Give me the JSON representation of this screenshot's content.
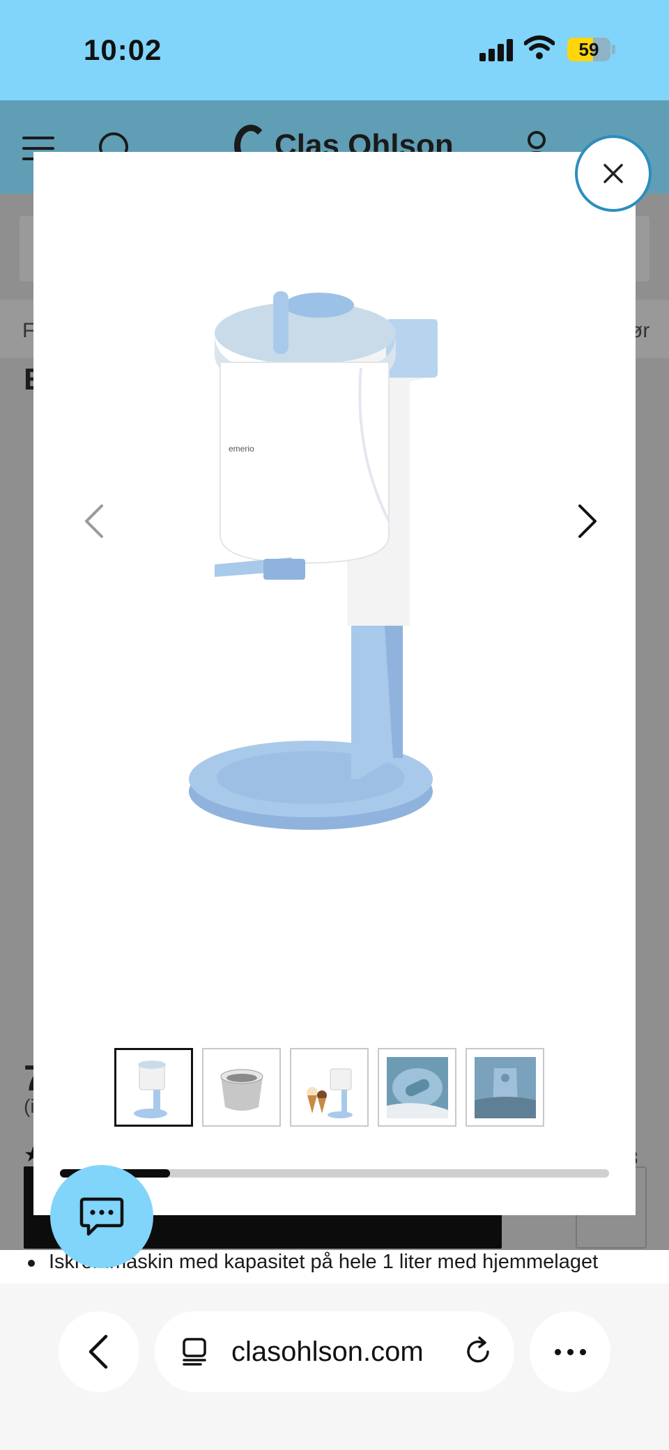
{
  "status_bar": {
    "time": "10:02",
    "battery_percent": "59",
    "battery_level": 0.59,
    "battery_color": "#ffd60a",
    "icons": [
      "cellular-signal-icon",
      "wifi-icon",
      "battery-icon"
    ]
  },
  "site_header": {
    "logo_text": "Clas Ohlson",
    "icons": [
      "menu-icon",
      "search-icon",
      "account-icon"
    ],
    "background_color": "#5f9eb4"
  },
  "page": {
    "breadcrumb_left": "F",
    "breadcrumb_right": "ør",
    "title_fragment": "E",
    "price_fragment": "7",
    "price_sub_fragment": "(i",
    "review_fragment": "3",
    "bullet_text": "Iskremmaskin med kapasitet på hele 1 liter med hjemmelaget"
  },
  "gallery": {
    "image_subject": "ice-cream-machine",
    "brand_mark": "emerio",
    "thumbnails": [
      {
        "name": "thumb-machine",
        "active": true
      },
      {
        "name": "thumb-bowl",
        "active": false
      },
      {
        "name": "thumb-cones",
        "active": false
      },
      {
        "name": "thumb-lid-dial",
        "active": false
      },
      {
        "name": "thumb-lid-closeup",
        "active": false
      }
    ],
    "progress": 0.2,
    "icons": [
      "chevron-left-icon",
      "chevron-right-icon",
      "close-icon"
    ],
    "accent_color": "#2b8dbf",
    "product_color": "#a9c9ea"
  },
  "chat": {
    "icon": "chat-bubble-icon",
    "background_color": "#81d4fa"
  },
  "browser": {
    "url": "clasohlson.com",
    "icons": [
      "back-icon",
      "tabs-icon",
      "reload-icon",
      "more-icon"
    ]
  }
}
